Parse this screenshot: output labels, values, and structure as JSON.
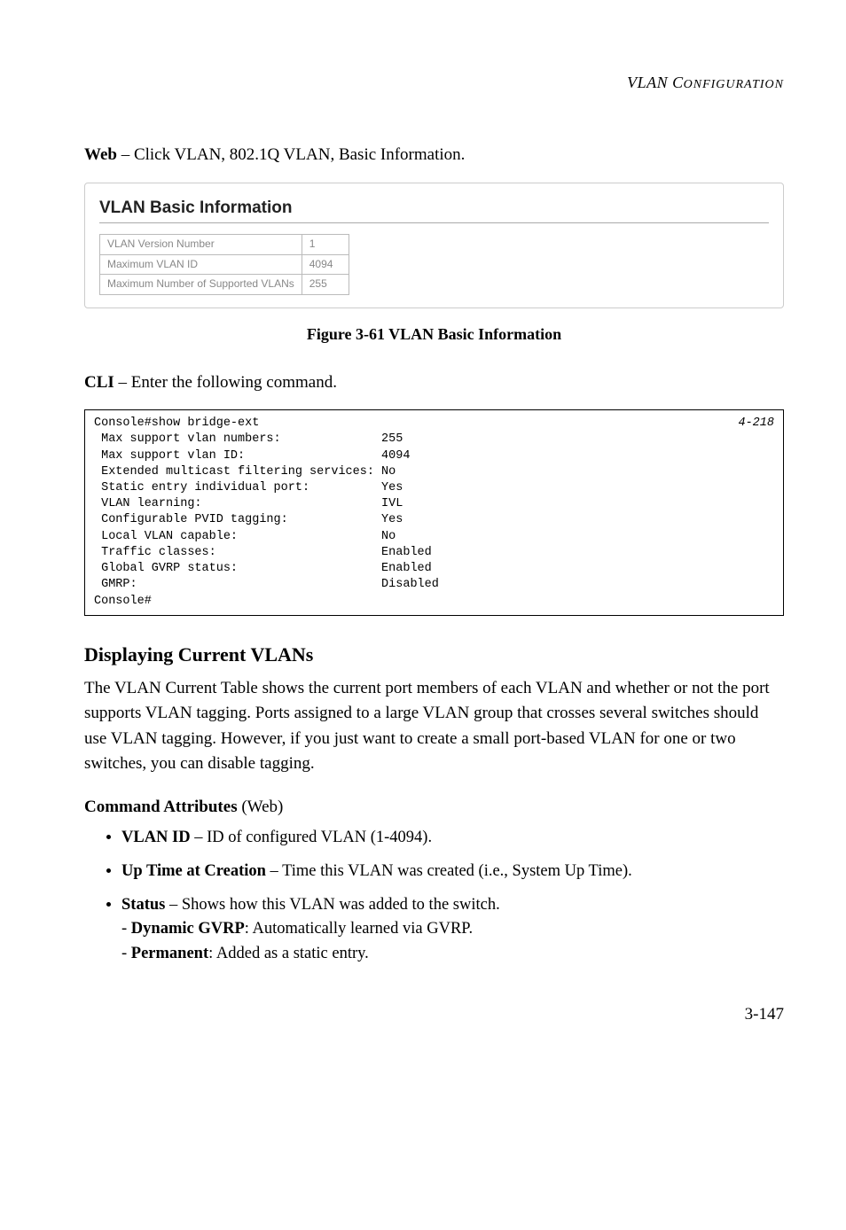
{
  "header": {
    "title_italic": "VLAN C",
    "title_sc": "ONFIGURATION"
  },
  "intro": {
    "label": "Web",
    "rest": " – Click VLAN, 802.1Q VLAN, Basic Information."
  },
  "screenshot": {
    "title": "VLAN Basic Information",
    "rows": [
      {
        "label": "VLAN Version Number",
        "value": "1"
      },
      {
        "label": "Maximum VLAN ID",
        "value": "4094"
      },
      {
        "label": "Maximum Number of Supported VLANs",
        "value": "255"
      }
    ]
  },
  "figure_caption": "Figure 3-61  VLAN Basic Information",
  "cli_intro": {
    "label": "CLI",
    "rest": " – Enter the following command."
  },
  "cli": {
    "cmd": "Console#show bridge-ext",
    "ref": "4-218",
    "lines": [
      " Max support vlan numbers:              255",
      " Max support vlan ID:                   4094",
      " Extended multicast filtering services: No",
      " Static entry individual port:          Yes",
      " VLAN learning:                         IVL",
      " Configurable PVID tagging:             Yes",
      " Local VLAN capable:                    No",
      " Traffic classes:                       Enabled",
      " Global GVRP status:                    Enabled",
      " GMRP:                                  Disabled",
      "Console#"
    ]
  },
  "section": {
    "title": "Displaying Current VLANs",
    "para": "The VLAN Current Table shows the current port members of each VLAN and whether or not the port supports VLAN tagging. Ports assigned to a large VLAN group that crosses several switches should use VLAN tagging. However, if you just want to create a small port-based VLAN for one or two switches, you can disable tagging."
  },
  "attrs": {
    "heading_bold": "Command Attributes",
    "heading_rest": " (Web)",
    "items": [
      {
        "name": "VLAN ID",
        "desc": " – ID of configured VLAN (1-4094)."
      },
      {
        "name": "Up Time at Creation",
        "desc": " – Time this VLAN was created (i.e., System Up Time)."
      },
      {
        "name": "Status",
        "desc": " – Shows how this VLAN was added to the switch.",
        "subs": [
          {
            "b": "Dynamic GVRP",
            "t": ": Automatically learned via GVRP."
          },
          {
            "b": "Permanent",
            "t": ": Added as a static entry."
          }
        ]
      }
    ]
  },
  "page_number": "3-147"
}
